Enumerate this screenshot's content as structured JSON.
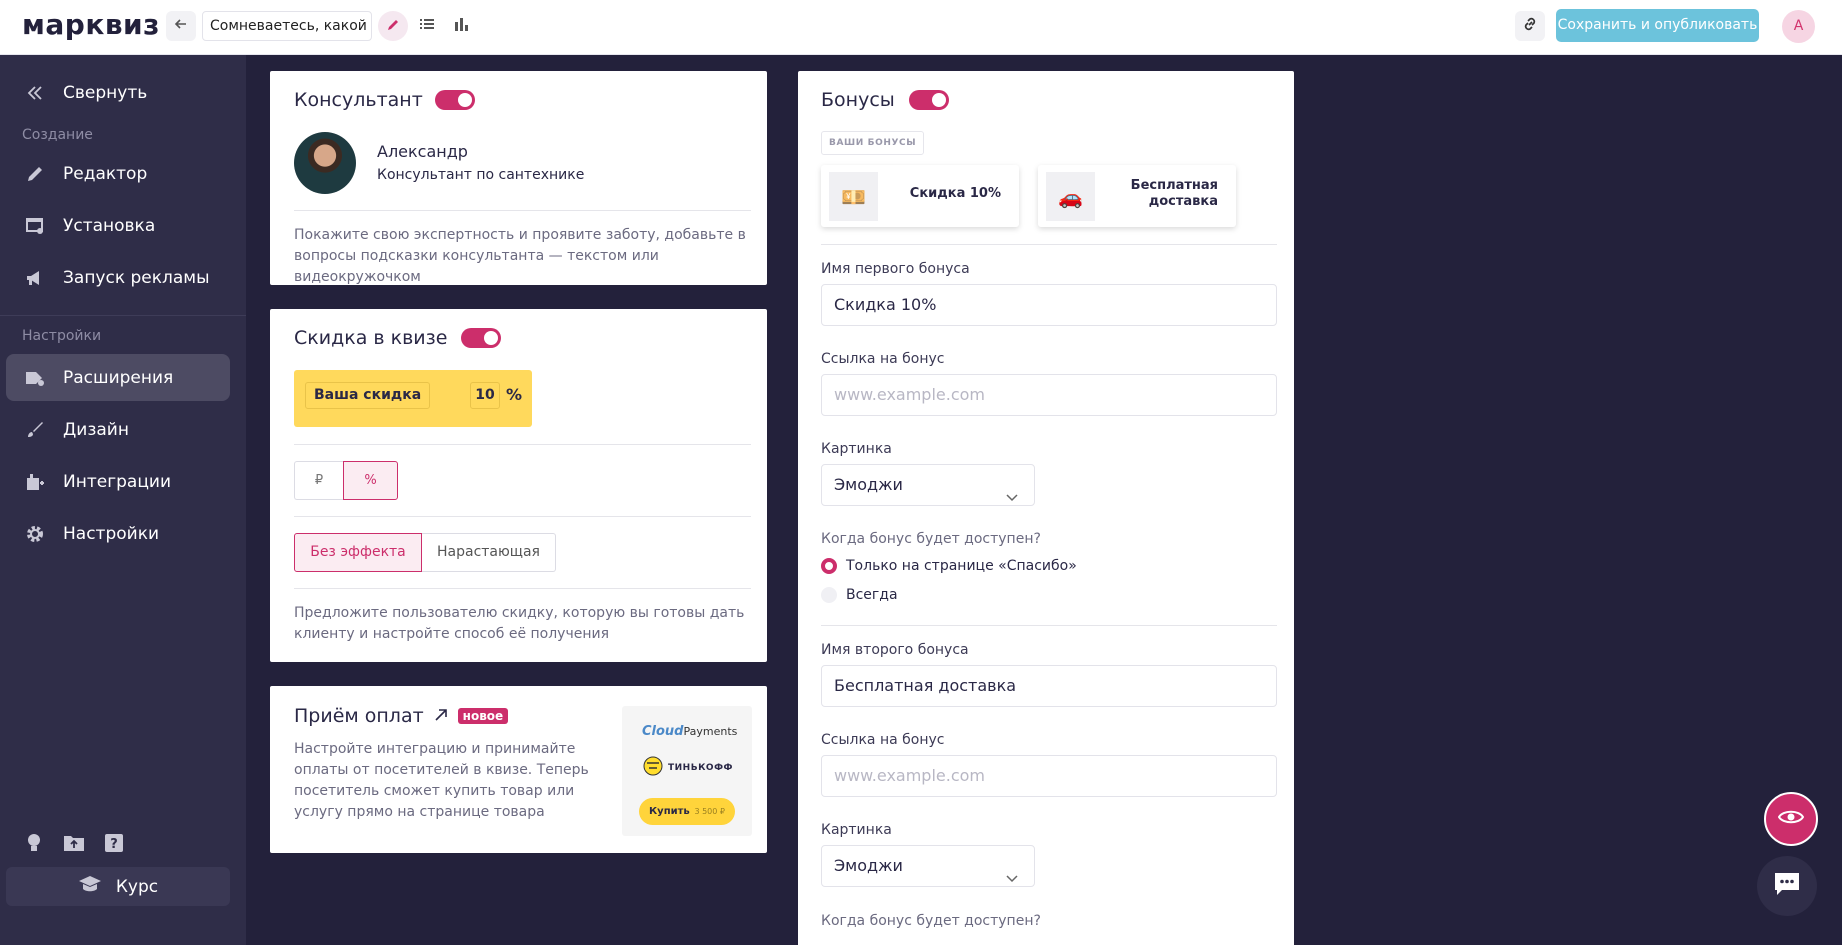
{
  "topbar": {
    "logo": "марквиз",
    "quiz_title": "Сомневаетесь, какой ...",
    "publish_label": "Сохранить и опубликовать",
    "avatar_letter": "А",
    "icons": [
      "arrow-left-icon",
      "pencil-icon",
      "list-icon",
      "bar-chart-icon",
      "link-icon"
    ]
  },
  "sidebar": {
    "collapse": "Свернуть",
    "section_create": "Создание",
    "section_settings": "Настройки",
    "items": [
      {
        "label": "Редактор",
        "icon": "pencil-icon"
      },
      {
        "label": "Установка",
        "icon": "install-icon"
      },
      {
        "label": "Запуск рекламы",
        "icon": "megaphone-icon"
      },
      {
        "label": "Расширения",
        "icon": "extensions-icon",
        "active": true
      },
      {
        "label": "Дизайн",
        "icon": "brush-icon"
      },
      {
        "label": "Интеграции",
        "icon": "integrations-icon"
      },
      {
        "label": "Настройки",
        "icon": "gear-icon"
      }
    ],
    "bottom_icons": [
      "lightbulb-icon",
      "upload-folder-icon",
      "help-icon"
    ],
    "course": "Курс"
  },
  "consultant": {
    "title": "Консультант",
    "enabled": true,
    "name": "Александр",
    "role": "Консультант по сантехнике",
    "description": "Покажите свою экспертность и проявите заботу, добавьте в вопросы подсказки консультанта — текстом или видеокружочком"
  },
  "discount": {
    "title": "Скидка в квизе",
    "enabled": true,
    "your_discount": "Ваша скидка",
    "value": "10",
    "unit": "%",
    "currency_options": [
      "₽",
      "%"
    ],
    "currency_selected": "%",
    "effect_options": [
      "Без эффекта",
      "Нарастающая"
    ],
    "effect_selected": "Без эффекта",
    "description": "Предложите пользователю скидку, которую вы готовы дать клиенту и настройте способ её получения",
    "accent_color": "#ffd95c"
  },
  "payments": {
    "title": "Приём оплат",
    "badge": "новое",
    "description": "Настройте интеграцию и принимайте оплаты от посетителей в квизе. Теперь посетитель сможет купить товар или услугу прямо на странице товара",
    "logo_cloud_1": "Cloud",
    "logo_cloud_2": "Payments",
    "logo_tinkoff": "ТИНЬКОФФ",
    "buy_label": "Купить",
    "buy_price": "3 500 ₽"
  },
  "bonuses": {
    "title": "Бонусы",
    "enabled": true,
    "your_bonuses": "ВАШИ БОНУСЫ",
    "bonus_cards": [
      {
        "emoji": "💴",
        "label": "Скидка 10%"
      },
      {
        "emoji": "🚗",
        "label": "Бесплатная доставка"
      }
    ],
    "first_name_label": "Имя первого бонуса",
    "first_name_value": "Скидка 10%",
    "link_label": "Ссылка на бонус",
    "link_placeholder": "www.example.com",
    "picture_label": "Картинка",
    "picture_value": "Эмоджи",
    "when_label": "Когда бонус будет доступен?",
    "when_options": [
      "Только на странице «Спасибо»",
      "Всегда"
    ],
    "when_selected": "Только на странице «Спасибо»",
    "second_name_label": "Имя второго бонуса",
    "second_name_value": "Бесплатная доставка"
  },
  "colors": {
    "accent": "#cc2e6b",
    "sidebar": "#2f2d48",
    "background": "#23213b",
    "publish": "#6cc3dc"
  }
}
